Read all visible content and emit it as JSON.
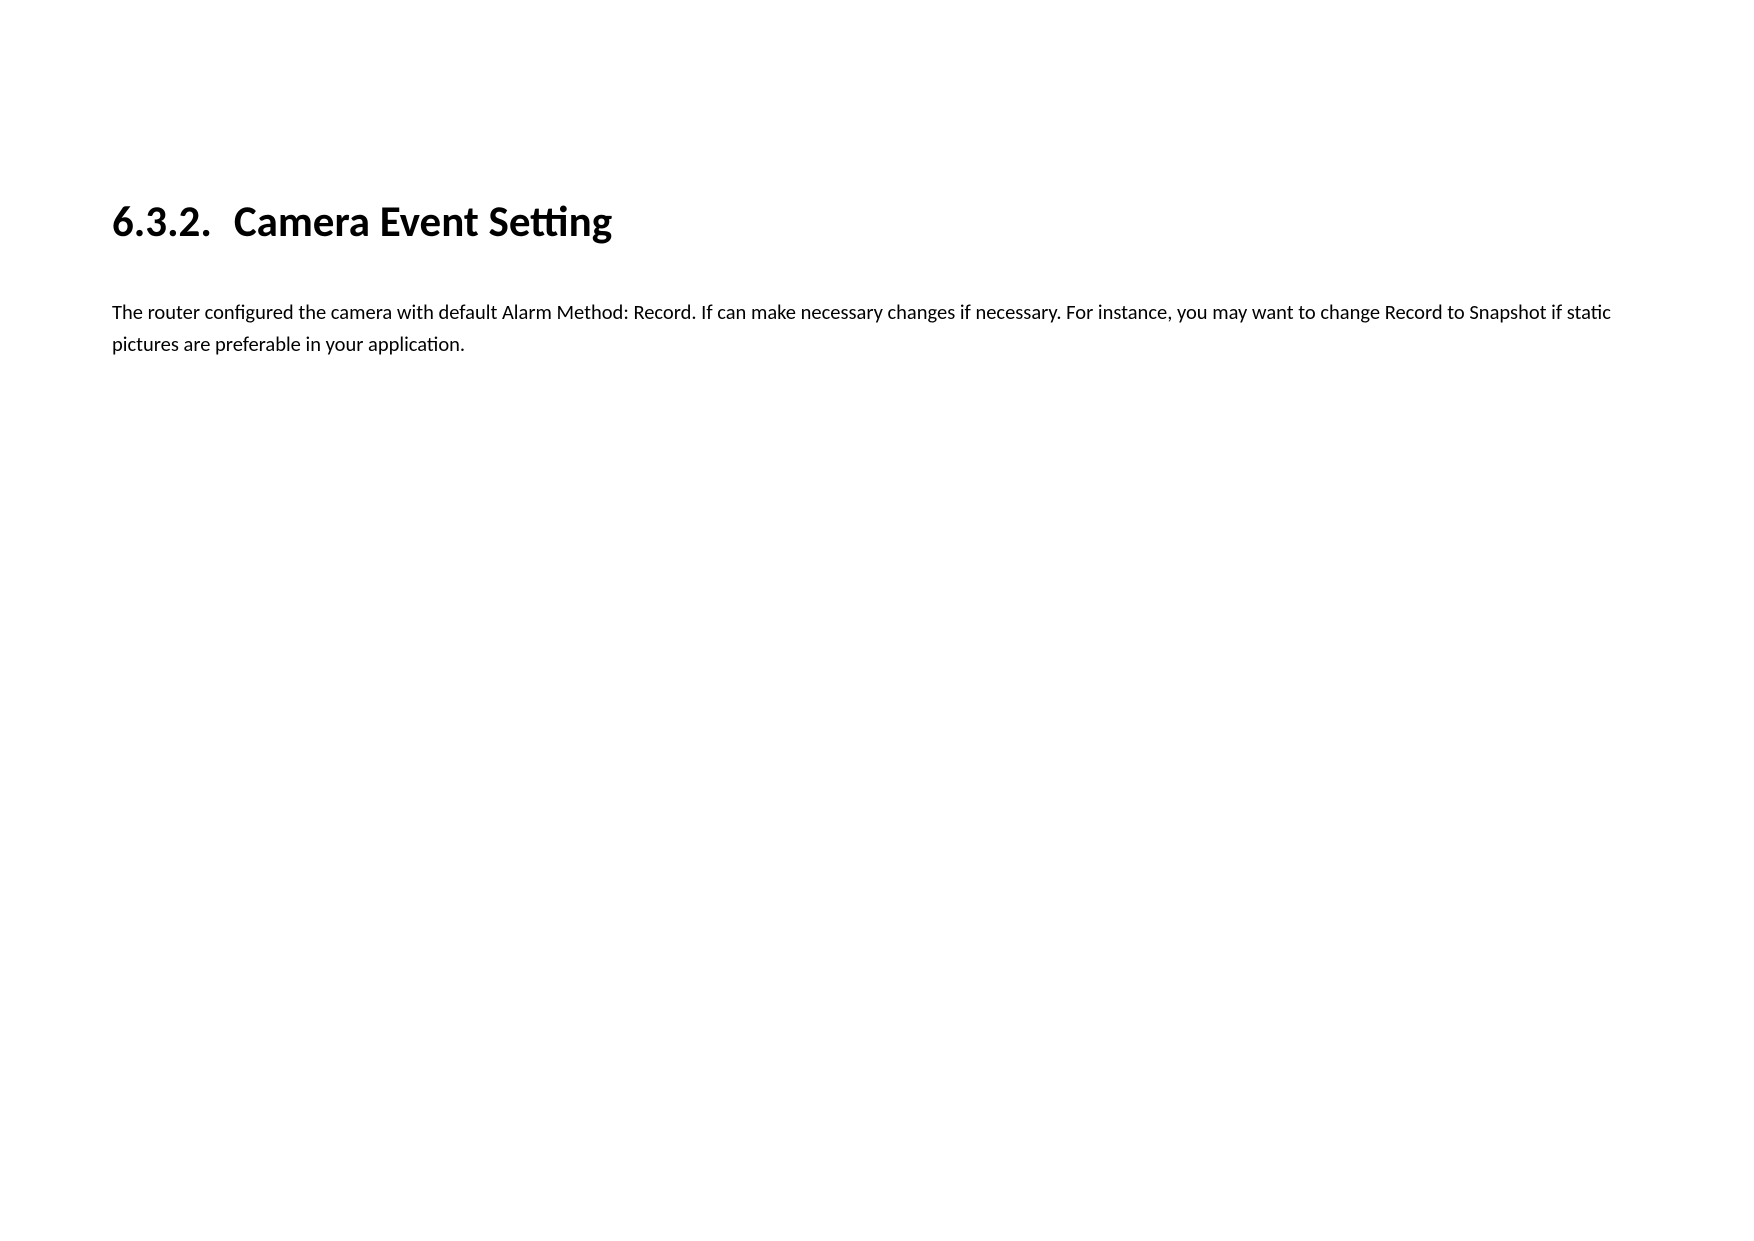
{
  "section": {
    "number": "6.3.2.",
    "title": "Camera Event Setting",
    "paragraph": "The router configured the camera with default Alarm Method: Record. If can make necessary changes if necessary. For instance, you may want to change Record to Snapshot if static pictures are preferable in your application."
  }
}
